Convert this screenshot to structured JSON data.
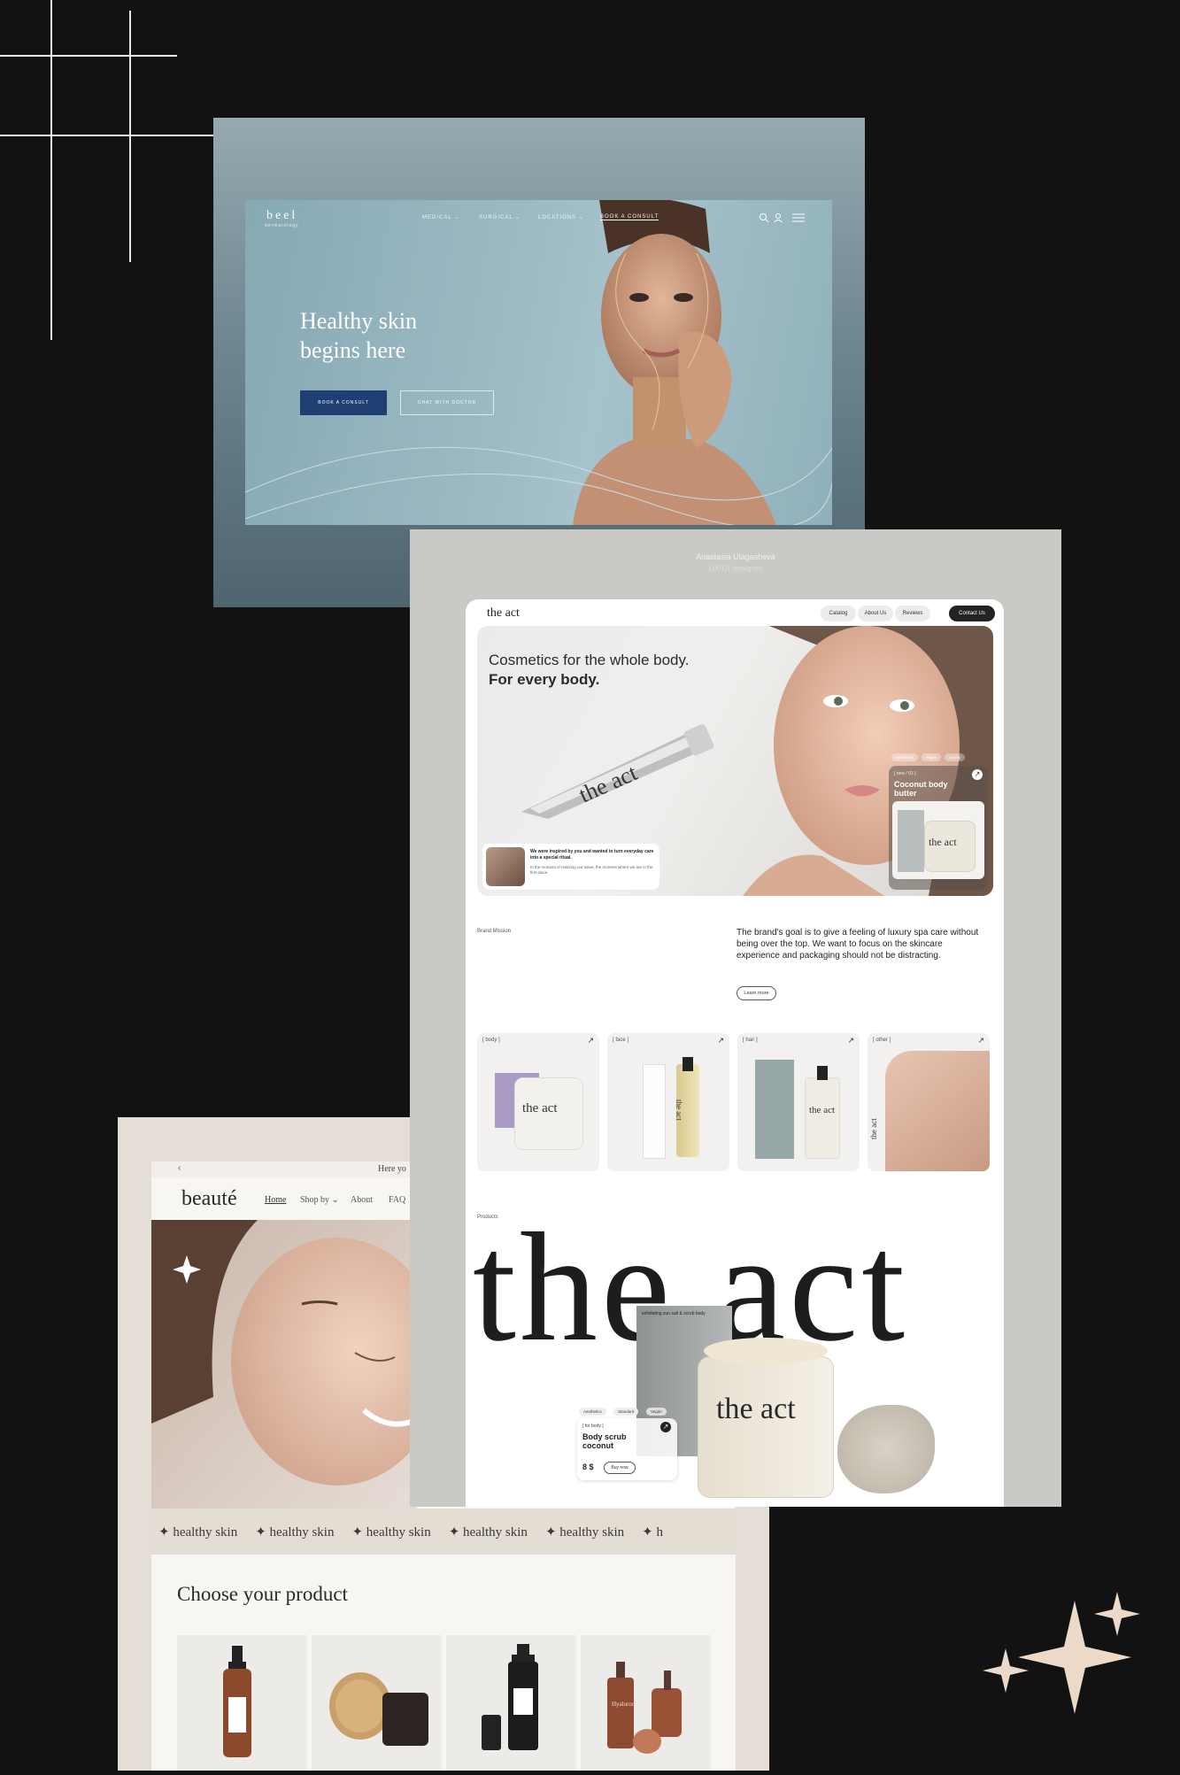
{
  "beel": {
    "logo": "beel",
    "logo_sub": "dermatology",
    "nav": [
      "MEDICAL ⌄",
      "SURGICAL ⌄",
      "LOCATIONS ⌄",
      "BOOK A CONSULT"
    ],
    "hero_title_line1": "Healthy skin",
    "hero_title_line2": "begins here",
    "primary_button": "BOOK A CONSULT",
    "secondary_button": "CHAT WITH DOCTOR",
    "colors": {
      "primary_button": "#1f3f73"
    }
  },
  "act": {
    "author_name": "Anastasia Ulagasheva",
    "author_role": "UX/UI designer",
    "logo": "the act",
    "nav": [
      "Catalog",
      "About Us",
      "Reviews"
    ],
    "contact_button": "Contact Us",
    "hero_title_part1": "Cosmetics for the whole body.",
    "hero_title_bold": "For every body.",
    "hero_card_title": "We were inspired by you and wanted to turn everyday care into a special ritual.",
    "hero_card_text": "In the moment of realizing our value, the moment where we are in the first place.",
    "hero_tags": [
      "aesthetics",
      "vegan",
      "cruelty"
    ],
    "hero_product_tag": "[ new / 01 ]",
    "hero_product_name": "Coconut body butter",
    "tube_text": "the act",
    "jar_text": "the act",
    "mission_label": "Brand Mission",
    "mission_text": "The brand's goal is to give a feeling of luxury spa care without being over the top. We want to focus on the skincare experience and packaging should not be distracting.",
    "learn_more": "Learn more",
    "categories": [
      {
        "label": "[ body ]",
        "product_text": "the act"
      },
      {
        "label": "[ face ]",
        "product_text": "the act"
      },
      {
        "label": "[ hair ]",
        "product_text": "the act"
      },
      {
        "label": "[ other ]",
        "product_text": "the act"
      }
    ],
    "products_label": "Products",
    "big_logo": "the act",
    "feature_jar_text": "the act",
    "feature_box_text": "exfoliating sun salt & scrub body",
    "feature_tags": [
      "Aesthetics",
      "Standard",
      "Vegan"
    ],
    "feature_tag": "[ for body ]",
    "feature_name": "Body scrub coconut",
    "feature_price": "8 $",
    "buy_button": "Buy now"
  },
  "beaute": {
    "logo": "beauté",
    "topbar_text": "Here yo",
    "nav": [
      "Home",
      "Shop by ⌄",
      "About",
      "FAQ"
    ],
    "marquee_items": [
      "✦ healthy skin",
      "✦ healthy skin",
      "✦ healthy skin",
      "✦ healthy skin",
      "✦ healthy skin",
      "✦ h"
    ],
    "section_title": "Choose your product",
    "bottle_label": "Hyaluronic Acid"
  }
}
